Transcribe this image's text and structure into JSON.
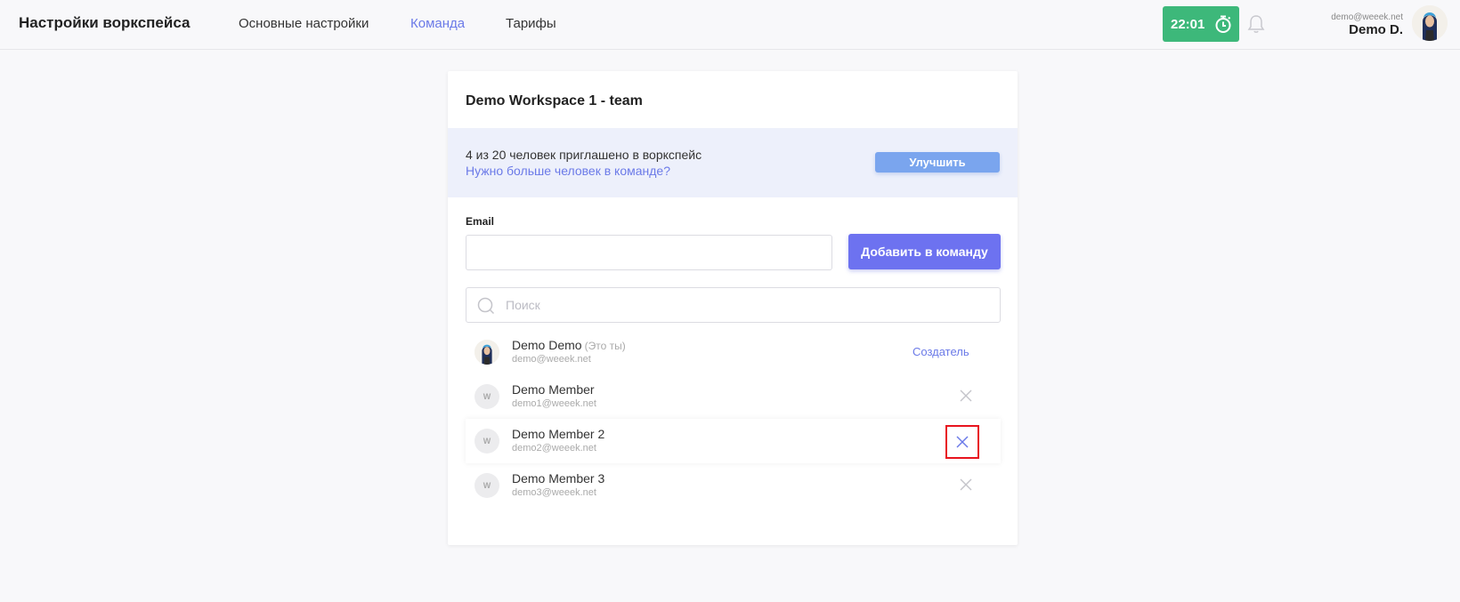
{
  "header": {
    "title": "Настройки воркспейса",
    "tabs": [
      {
        "label": "Основные настройки",
        "active": false
      },
      {
        "label": "Команда",
        "active": true
      },
      {
        "label": "Тарифы",
        "active": false
      }
    ],
    "timer": "22:01",
    "user_email": "demo@weeek.net",
    "user_name": "Demo D."
  },
  "card": {
    "title": "Demo Workspace 1 - team",
    "banner": {
      "text": "4 из 20 человек приглашено в воркспейс",
      "link": "Нужно больше человек в команде?",
      "upgrade_label": "Улучшить"
    },
    "email_label": "Email",
    "email_value": "",
    "add_label": "Добавить в команду",
    "search_placeholder": "Поиск"
  },
  "members": [
    {
      "name": "Demo Demo",
      "you": "(Это ты)",
      "email": "demo@weeek.net",
      "role": "Создатель",
      "avatar": "photo"
    },
    {
      "name": "Demo Member",
      "you": "",
      "email": "demo1@weeek.net",
      "role": "",
      "avatar": "W"
    },
    {
      "name": "Demo Member 2",
      "you": "",
      "email": "demo2@weeek.net",
      "role": "",
      "avatar": "W"
    },
    {
      "name": "Demo Member 3",
      "you": "",
      "email": "demo3@weeek.net",
      "role": "",
      "avatar": "W"
    }
  ],
  "colors": {
    "accent": "#6b7ae8",
    "timer": "#3db87a",
    "add_button": "#6d72f0",
    "upgrade_button": "#7aa5ee",
    "focus_outline": "#e8141e"
  }
}
